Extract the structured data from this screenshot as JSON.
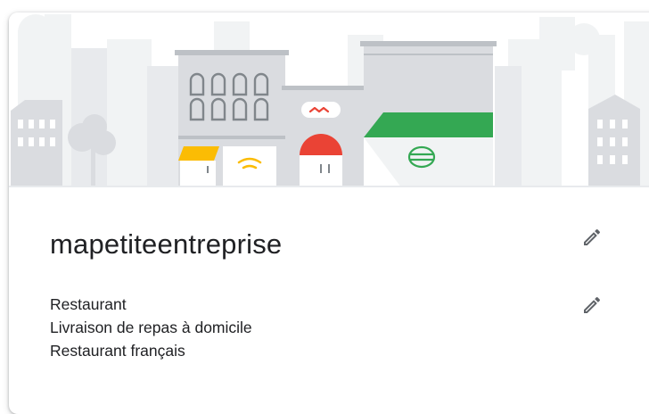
{
  "business": {
    "name": "mapetiteentreprise",
    "categories": [
      "Restaurant",
      "Livraison de repas à domicile",
      "Restaurant français"
    ]
  },
  "icons": {
    "edit_name": "pencil-icon",
    "edit_categories": "pencil-icon"
  },
  "colors": {
    "text": "#202124",
    "icon": "#5f6368",
    "awning_green": "#34a853",
    "awning_red": "#ea4335",
    "awning_yellow": "#fbbc04"
  }
}
